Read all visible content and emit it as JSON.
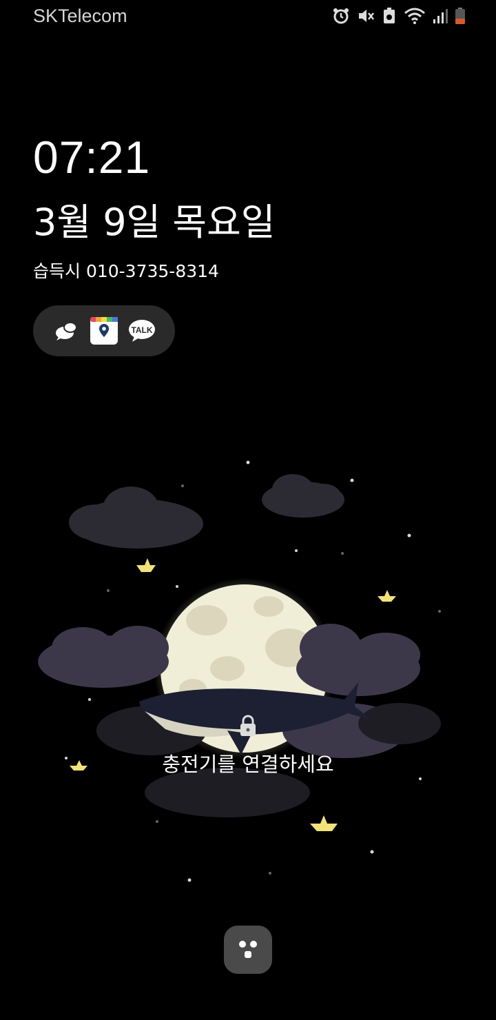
{
  "status_bar": {
    "carrier": "SKTelecom",
    "icons": [
      "alarm-icon",
      "mute-icon",
      "battery-saver-icon",
      "wifi-icon",
      "signal-icon",
      "battery-icon"
    ]
  },
  "lockscreen": {
    "time": "07:21",
    "date": "3월 9일 목요일",
    "owner_info": "습득시 010-3735-8314",
    "notification_apps": [
      "chat-bubble-icon",
      "gayo-app-icon",
      "kakaotalk-icon"
    ],
    "charge_hint": "충전기를 연결하세요",
    "bottom_button_icon": "bixby-icon"
  },
  "colors": {
    "background": "#000000",
    "pill": "#2a2a2a",
    "moon": "#f1eed8",
    "boat": "#f2e27a"
  }
}
